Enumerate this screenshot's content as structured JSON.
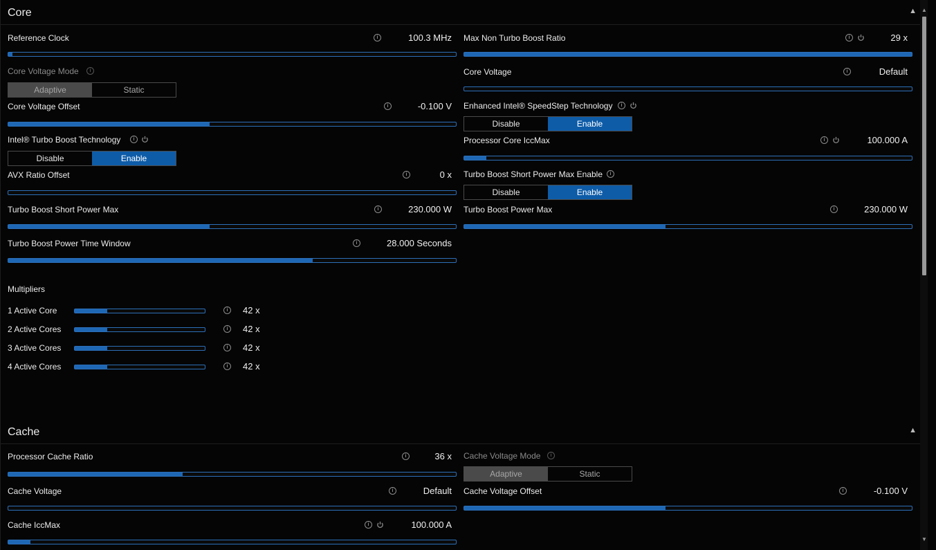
{
  "core": {
    "title": "Core",
    "reference_clock": {
      "label": "Reference Clock",
      "value": "100.3 MHz",
      "level": 0.01
    },
    "max_non_turbo": {
      "label": "Max Non Turbo Boost Ratio",
      "value": "29 x",
      "level": 1.0
    },
    "core_voltage_mode": {
      "label": "Core Voltage Mode",
      "options": [
        "Adaptive",
        "Static"
      ],
      "selected": "Adaptive"
    },
    "core_voltage": {
      "label": "Core Voltage",
      "value": "Default",
      "level": 0.0
    },
    "core_voltage_offset": {
      "label": "Core Voltage Offset",
      "value": "-0.100 V",
      "level": 0.45
    },
    "speedstep": {
      "label": "Enhanced Intel® SpeedStep Technology",
      "options": [
        "Disable",
        "Enable"
      ],
      "selected": "Enable"
    },
    "turbo_boost_tech": {
      "label": "Intel® Turbo Boost Technology",
      "options": [
        "Disable",
        "Enable"
      ],
      "selected": "Enable"
    },
    "core_iccmax": {
      "label": "Processor Core IccMax",
      "value": "100.000 A",
      "level": 0.05
    },
    "avx_offset": {
      "label": "AVX Ratio Offset",
      "value": "0 x",
      "level": 0.0
    },
    "short_power_max_enable": {
      "label": "Turbo Boost Short Power Max Enable",
      "options": [
        "Disable",
        "Enable"
      ],
      "selected": "Enable"
    },
    "short_power_max": {
      "label": "Turbo Boost Short Power Max",
      "value": "230.000 W",
      "level": 0.45
    },
    "power_max": {
      "label": "Turbo Boost Power Max",
      "value": "230.000 W",
      "level": 0.45
    },
    "time_window": {
      "label": "Turbo Boost Power Time Window",
      "value": "28.000 Seconds",
      "level": 0.68
    }
  },
  "multipliers": {
    "title": "Multipliers",
    "rows": [
      {
        "label": "1 Active Core",
        "value": "42 x",
        "level": 0.25
      },
      {
        "label": "2 Active Cores",
        "value": "42 x",
        "level": 0.25
      },
      {
        "label": "3 Active Cores",
        "value": "42 x",
        "level": 0.25
      },
      {
        "label": "4 Active Cores",
        "value": "42 x",
        "level": 0.25
      }
    ]
  },
  "cache": {
    "title": "Cache",
    "ratio": {
      "label": "Processor Cache Ratio",
      "value": "36 x",
      "level": 0.39
    },
    "voltage_mode": {
      "label": "Cache Voltage Mode",
      "options": [
        "Adaptive",
        "Static"
      ],
      "selected": "Adaptive"
    },
    "voltage": {
      "label": "Cache Voltage",
      "value": "Default",
      "level": 0.0
    },
    "voltage_offset": {
      "label": "Cache Voltage Offset",
      "value": "-0.100 V",
      "level": 0.45
    },
    "iccmax": {
      "label": "Cache IccMax",
      "value": "100.000 A",
      "level": 0.05
    }
  },
  "icons": {
    "info": "info-circle-icon",
    "power": "power-icon",
    "collapse": "chevron-up-icon"
  },
  "colors": {
    "accent": "#1e67b5",
    "selected": "#0e5ca8",
    "background": "#050505"
  }
}
